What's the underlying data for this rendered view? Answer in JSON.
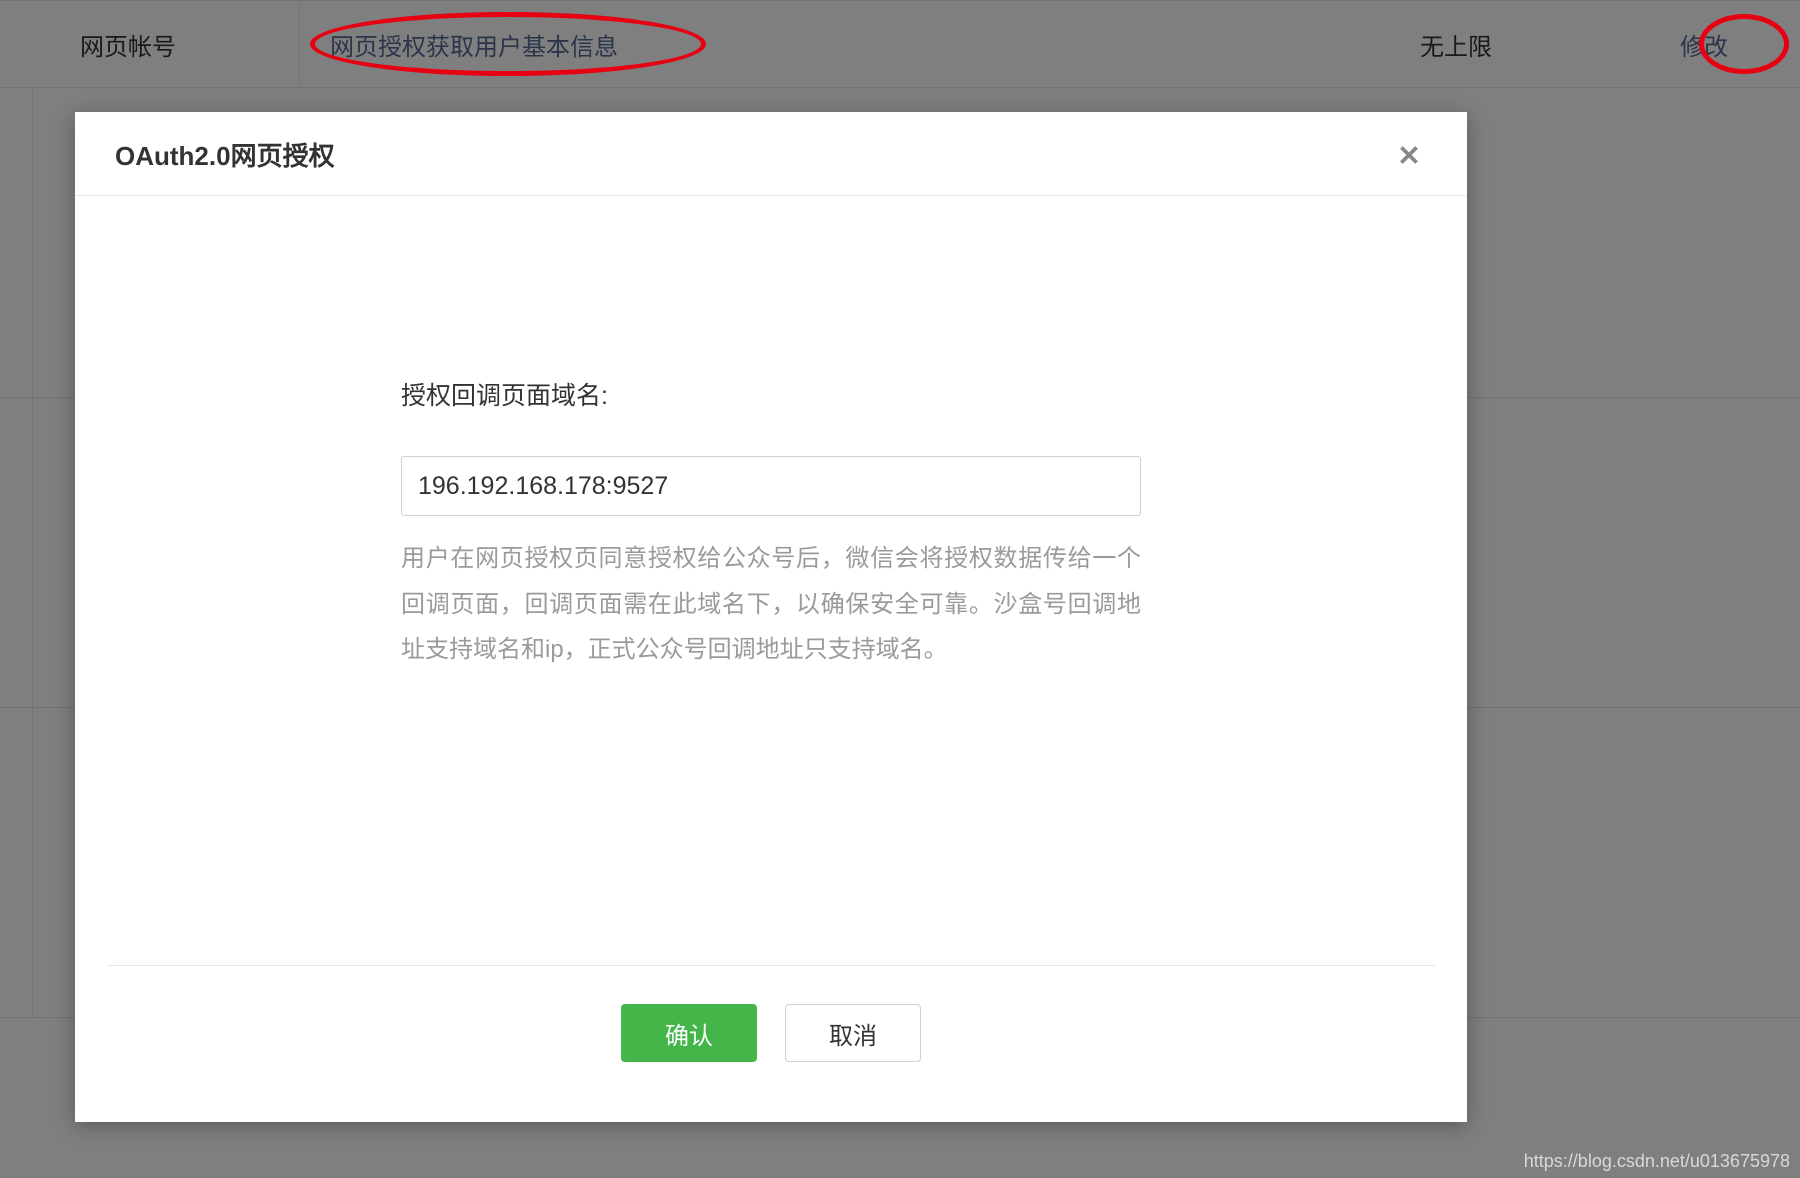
{
  "background_row": {
    "label": "网页帐号",
    "link_text": "网页授权获取用户基本信息",
    "limit_text": "无上限",
    "action_text": "修改"
  },
  "modal": {
    "title": "OAuth2.0网页授权",
    "form_label": "授权回调页面域名:",
    "input_value": "196.192.168.178:9527",
    "help_text": "用户在网页授权页同意授权给公众号后，微信会将授权数据传给一个回调页面，回调页面需在此域名下，以确保安全可靠。沙盒号回调地址支持域名和ip，正式公众号回调地址只支持域名。",
    "confirm_label": "确认",
    "cancel_label": "取消"
  },
  "watermark": "https://blog.csdn.net/u013675978"
}
